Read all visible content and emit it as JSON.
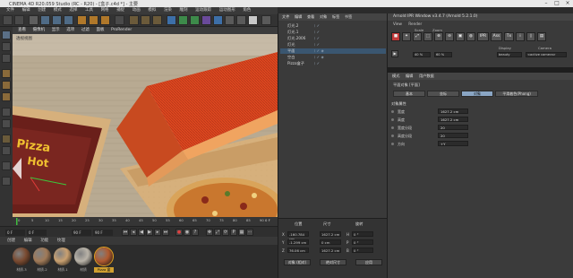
{
  "window": {
    "title": "CINEMA 4D R20.059 Studio (RC - R20) - [盒子.c4d *] - 主要"
  },
  "menubar": [
    "文件",
    "编辑",
    "创建",
    "模式",
    "选择",
    "工具",
    "网格",
    "捕捉",
    "动画",
    "模拟",
    "渲染",
    "雕刻",
    "运动跟踪",
    "运动图形",
    "角色",
    "流水线",
    "插件",
    "Arnold",
    "脚本",
    "窗口",
    "帮助"
  ],
  "viewport": {
    "menu": [
      "查看",
      "摄像机",
      "显示",
      "选项",
      "过滤",
      "面板",
      "ProRender"
    ],
    "camera_label": "透视视图",
    "pizza_box_text": [
      "Pizza",
      "Hot"
    ]
  },
  "timeline": {
    "ticks": [
      "0",
      "5",
      "10",
      "15",
      "20",
      "25",
      "30",
      "35",
      "40",
      "45",
      "50",
      "55",
      "60",
      "65",
      "70",
      "75",
      "80",
      "85",
      "90"
    ],
    "current": "0 F",
    "frame_start": "0 F",
    "frame_start2": "0 F",
    "frame_end": "90 F",
    "frame_end2": "90 F"
  },
  "materials": {
    "menu": [
      "创建",
      "编辑",
      "功能",
      "纹理"
    ],
    "items": [
      {
        "name": "材质.3",
        "color": "#7a4a30"
      },
      {
        "name": "材质.2",
        "color": "#a07a58"
      },
      {
        "name": "材质.1",
        "color": "#c9a070"
      },
      {
        "name": "材质",
        "color": "#b9b3a8"
      },
      {
        "name": "Pizza 盒",
        "color": "#b05a30"
      }
    ]
  },
  "object_manager": {
    "menu": [
      "文件",
      "编辑",
      "查看",
      "对象",
      "标签",
      "书签"
    ],
    "rows": [
      {
        "name": "灯光.2",
        "flags": "⁝ ✓"
      },
      {
        "name": "灯光.1",
        "flags": "⁝ ✓"
      },
      {
        "name": "灯光.2006",
        "flags": "⁝ ✓"
      },
      {
        "name": "灯光",
        "flags": "⁝ ✓"
      },
      {
        "name": "平面",
        "flags": "⁝ ✓ ◈"
      },
      {
        "name": "空白",
        "flags": "⁝ ✓ ◈"
      },
      {
        "name": "Pizza盒子",
        "flags": "⁝ ✓"
      }
    ]
  },
  "coordinates": {
    "headers": [
      "位置",
      "尺寸",
      "旋转"
    ],
    "rows": [
      {
        "axis": "X",
        "pos": "-160.784 cm",
        "size": "1627.2 cm",
        "rot_label": "H",
        "rot": "0 °"
      },
      {
        "axis": "Y",
        "pos": "-1.299 cm",
        "size": "0 cm",
        "rot_label": "P",
        "rot": "0 °"
      },
      {
        "axis": "Z",
        "pos": "76.06 cm",
        "size": "1627.2 cm",
        "rot_label": "B",
        "rot": "0 °"
      }
    ],
    "mode_btn": "对象 (相对)",
    "size_btn": "绝对尺寸",
    "apply_btn": "应用"
  },
  "ipr": {
    "title": "Arnold IPR Window v3.4.7 (Arnold 5.2.1.0)",
    "menu": [
      "View",
      "Render"
    ],
    "labels": {
      "scale": "Scale",
      "zoom": "Zoom",
      "display": "Display",
      "camera": "Camera"
    },
    "values": {
      "scale": "40 %",
      "zoom": "60 %",
      "display": "beauty",
      "camera": "<active camera>"
    },
    "buttons": [
      "IPR",
      "Ass",
      "Tx"
    ]
  },
  "attributes": {
    "menu": [
      "模式",
      "编辑",
      "用户数据"
    ],
    "title": "平面对象 [平面]",
    "tabs": [
      "基本",
      "坐标",
      "对象",
      "平滑着色(Phong)"
    ],
    "active_tab": 2,
    "section": "对象属性",
    "rows": [
      {
        "label": "宽度",
        "value": "1627.2 cm"
      },
      {
        "label": "高度",
        "value": "1627.2 cm"
      },
      {
        "label": "宽度分段",
        "value": "20"
      },
      {
        "label": "高度分段",
        "value": "20"
      },
      {
        "label": "方向",
        "value": "+Y"
      }
    ]
  }
}
